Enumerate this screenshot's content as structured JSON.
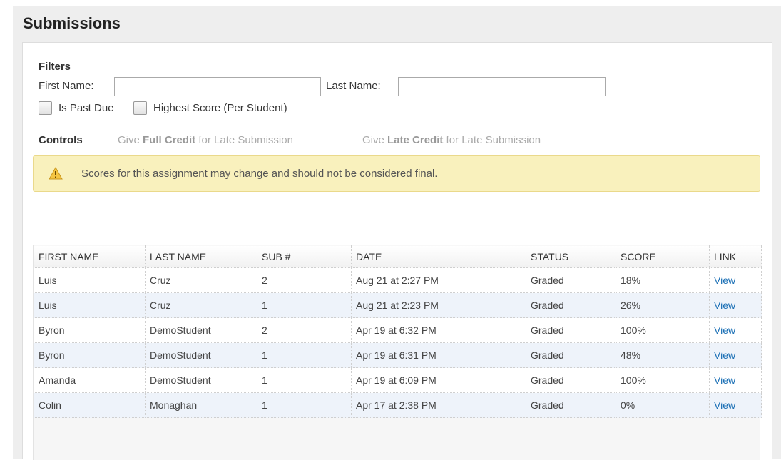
{
  "page": {
    "title": "Submissions"
  },
  "filters": {
    "heading": "Filters",
    "first_name_label": "First Name:",
    "first_name_value": "",
    "last_name_label": "Last Name:",
    "last_name_value": "",
    "past_due_label": "Is Past Due",
    "past_due_checked": false,
    "highest_score_label": "Highest Score (Per Student)",
    "highest_score_checked": false
  },
  "controls": {
    "label": "Controls",
    "full_credit": {
      "prefix": "Give ",
      "bold": "Full Credit",
      "suffix": " for Late Submission"
    },
    "late_credit": {
      "prefix": "Give ",
      "bold": "Late Credit",
      "suffix": " for Late Submission"
    }
  },
  "alert": {
    "icon": "warning-icon",
    "message": "Scores for this assignment may change and should not be considered final.",
    "background": "#f9f1bd"
  },
  "table": {
    "columns": [
      "FIRST NAME",
      "LAST NAME",
      "SUB #",
      "DATE",
      "STATUS",
      "SCORE",
      "LINK"
    ],
    "rows": [
      {
        "first_name": "Luis",
        "last_name": "Cruz",
        "sub": "2",
        "date": "Aug 21 at 2:27 PM",
        "status": "Graded",
        "score": "18%",
        "link": "View"
      },
      {
        "first_name": "Luis",
        "last_name": "Cruz",
        "sub": "1",
        "date": "Aug 21 at 2:23 PM",
        "status": "Graded",
        "score": "26%",
        "link": "View"
      },
      {
        "first_name": "Byron",
        "last_name": "DemoStudent",
        "sub": "2",
        "date": "Apr 19 at 6:32 PM",
        "status": "Graded",
        "score": "100%",
        "link": "View"
      },
      {
        "first_name": "Byron",
        "last_name": "DemoStudent",
        "sub": "1",
        "date": "Apr 19 at 6:31 PM",
        "status": "Graded",
        "score": "48%",
        "link": "View"
      },
      {
        "first_name": "Amanda",
        "last_name": "DemoStudent",
        "sub": "1",
        "date": "Apr 19 at 6:09 PM",
        "status": "Graded",
        "score": "100%",
        "link": "View"
      },
      {
        "first_name": "Colin",
        "last_name": "Monaghan",
        "sub": "1",
        "date": "Apr 17 at 2:38 PM",
        "status": "Graded",
        "score": "0%",
        "link": "View"
      }
    ],
    "link_color": "#1a6fb5",
    "alt_row_color": "#eef3fa"
  }
}
